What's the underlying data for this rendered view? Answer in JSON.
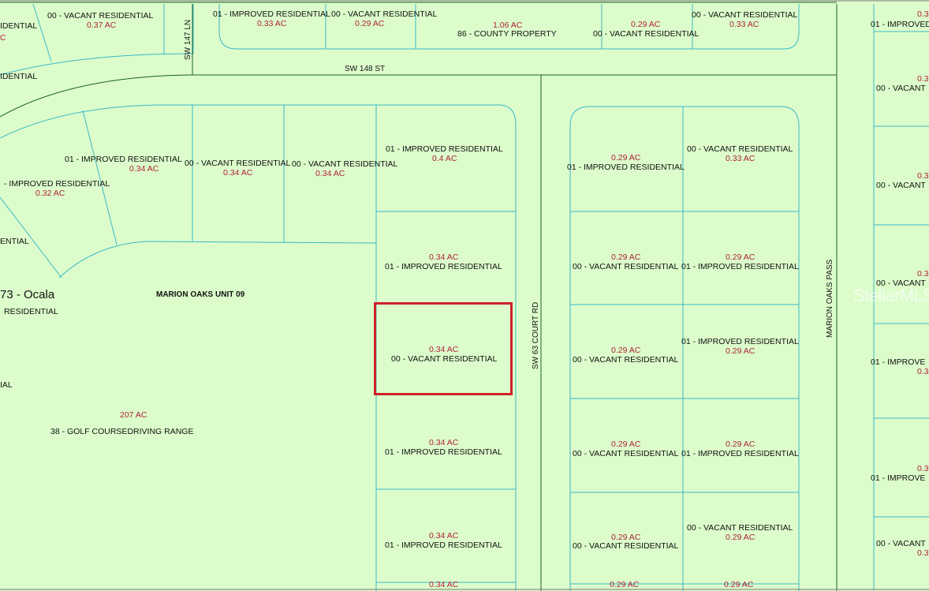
{
  "map": {
    "streets": {
      "sw148st": "SW 148 ST",
      "sw147ln": "SW 147 LN",
      "sw63court": "SW 63 COURT RD",
      "marionoakspass": "MARION OAKS PASS"
    },
    "subdivision": "MARION OAKS UNIT 09",
    "city_fragment": "73 - Ocala",
    "golf": {
      "acres": "207 AC",
      "use": "38 - GOLF COURSEDRIVING RANGE"
    },
    "watermark": "StellarMLS",
    "colors": {
      "parcel_fill": "#dcfdcb",
      "parcel_line": "#3bb8c8",
      "road_line": "#1a5e2a",
      "highlight": "#d0202a",
      "acre_text": "#b0203a"
    },
    "top_row": [
      {
        "use": "00 - VACANT RESIDENTIAL",
        "acres": "0.37 AC"
      },
      {
        "use": "01 - IMPROVED RESIDENTIAL",
        "acres": "0.33 AC"
      },
      {
        "use": "00 - VACANT RESIDENTIAL",
        "acres": "0.29 AC"
      },
      {
        "use": "86 - COUNTY PROPERTY",
        "acres": "1.06 AC"
      },
      {
        "use": "00 - VACANT RESIDENTIAL",
        "acres": "0.29 AC"
      },
      {
        "use": "00 - VACANT RESIDENTIAL",
        "acres": "0.33 AC"
      },
      {
        "use": "01 - IMPROVED"
      },
      {
        "use": "IDENTIAL"
      },
      {
        "use": "C"
      },
      {
        "use": "IDENTIAL"
      }
    ],
    "left_area": [
      {
        "use": "01 - IMPROVED RESIDENTIAL",
        "acres": "0.34 AC"
      },
      {
        "use": "00 - VACANT RESIDENTIAL",
        "acres": "0.34 AC"
      },
      {
        "use": "00 - VACANT RESIDENTIAL",
        "acres": "0.34 AC"
      },
      {
        "use": "- IMPROVED RESIDENTIAL",
        "acres": "0.32 AC"
      },
      {
        "use": "ENTIAL"
      },
      {
        "use": "RESIDENTIAL"
      },
      {
        "use": "IAL"
      }
    ],
    "col_a": [
      {
        "use": "01 - IMPROVED RESIDENTIAL",
        "acres": "0.4 AC"
      },
      {
        "use": "01 - IMPROVED RESIDENTIAL",
        "acres": "0.34 AC"
      },
      {
        "use": "00 - VACANT RESIDENTIAL",
        "acres": "0.34 AC"
      },
      {
        "use": "01 - IMPROVED RESIDENTIAL",
        "acres": "0.34 AC"
      },
      {
        "use": "01 - IMPROVED RESIDENTIAL",
        "acres": "0.34 AC"
      },
      {
        "acres": "0.34 AC"
      }
    ],
    "col_b": [
      {
        "use": "01 - IMPROVED RESIDENTIAL",
        "acres": "0.29 AC"
      },
      {
        "use": "00 - VACANT RESIDENTIAL",
        "acres": "0.29 AC"
      },
      {
        "use": "00 - VACANT RESIDENTIAL",
        "acres": "0.29 AC"
      },
      {
        "use": "00 - VACANT RESIDENTIAL",
        "acres": "0.29 AC"
      },
      {
        "use": "00 - VACANT RESIDENTIAL",
        "acres": "0.29 AC"
      },
      {
        "acres": "0.29 AC"
      }
    ],
    "col_c": [
      {
        "use": "00 - VACANT RESIDENTIAL",
        "acres": "0.33 AC"
      },
      {
        "use": "01 - IMPROVED RESIDENTIAL",
        "acres": "0.29 AC"
      },
      {
        "use": "01 - IMPROVED RESIDENTIAL",
        "acres": "0.29 AC"
      },
      {
        "use": "01 - IMPROVED RESIDENTIAL",
        "acres": "0.29 AC"
      },
      {
        "use": "00 - VACANT RESIDENTIAL",
        "acres": "0.29 AC"
      },
      {
        "acres": "0.29 AC"
      }
    ],
    "col_d": [
      {
        "use": "01 - IMPROVED",
        "acres": "0.3"
      },
      {
        "use": "00 - VACANT",
        "acres": "0.3"
      },
      {
        "use": "00 - VACANT",
        "acres": "0.3"
      },
      {
        "use": "00 - VACANT",
        "acres": "0.3"
      },
      {
        "use": "01 - IMPROVE",
        "acres": "0.3"
      },
      {
        "use": "01 - IMPROVE",
        "acres": "0.3"
      },
      {
        "use": "00 - VACANT",
        "acres": "0.3"
      }
    ]
  }
}
